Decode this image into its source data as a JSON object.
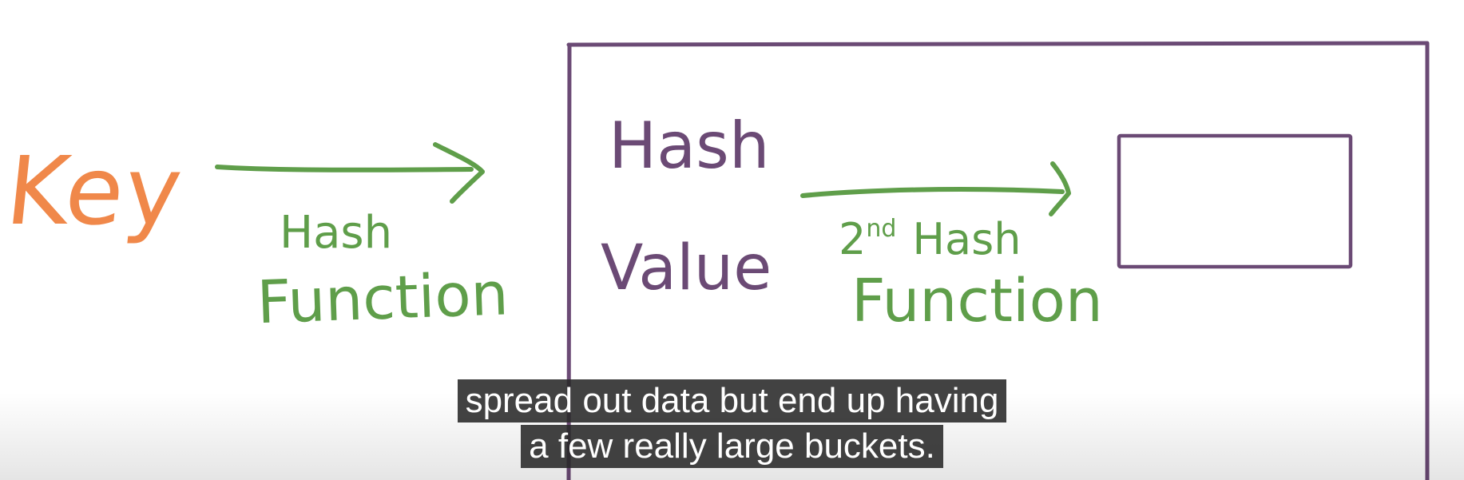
{
  "colors": {
    "key": "#f0884a",
    "hash_function": "#5f9e4a",
    "box": "#6b4a75",
    "caption_bg": "#2a2a2a",
    "caption_text": "#ffffff"
  },
  "diagram": {
    "key_label": "Key",
    "hash_function_line1": "Hash",
    "hash_function_line2": "Function",
    "hash_value_line1": "Hash",
    "hash_value_line2": "Value",
    "second_hash_prefix": "2",
    "second_hash_sup": "nd",
    "second_hash_word": "Hash",
    "second_hash_line2": "Function"
  },
  "captions": {
    "line1": "spread out data but end up having",
    "line2": "a few really large buckets."
  }
}
